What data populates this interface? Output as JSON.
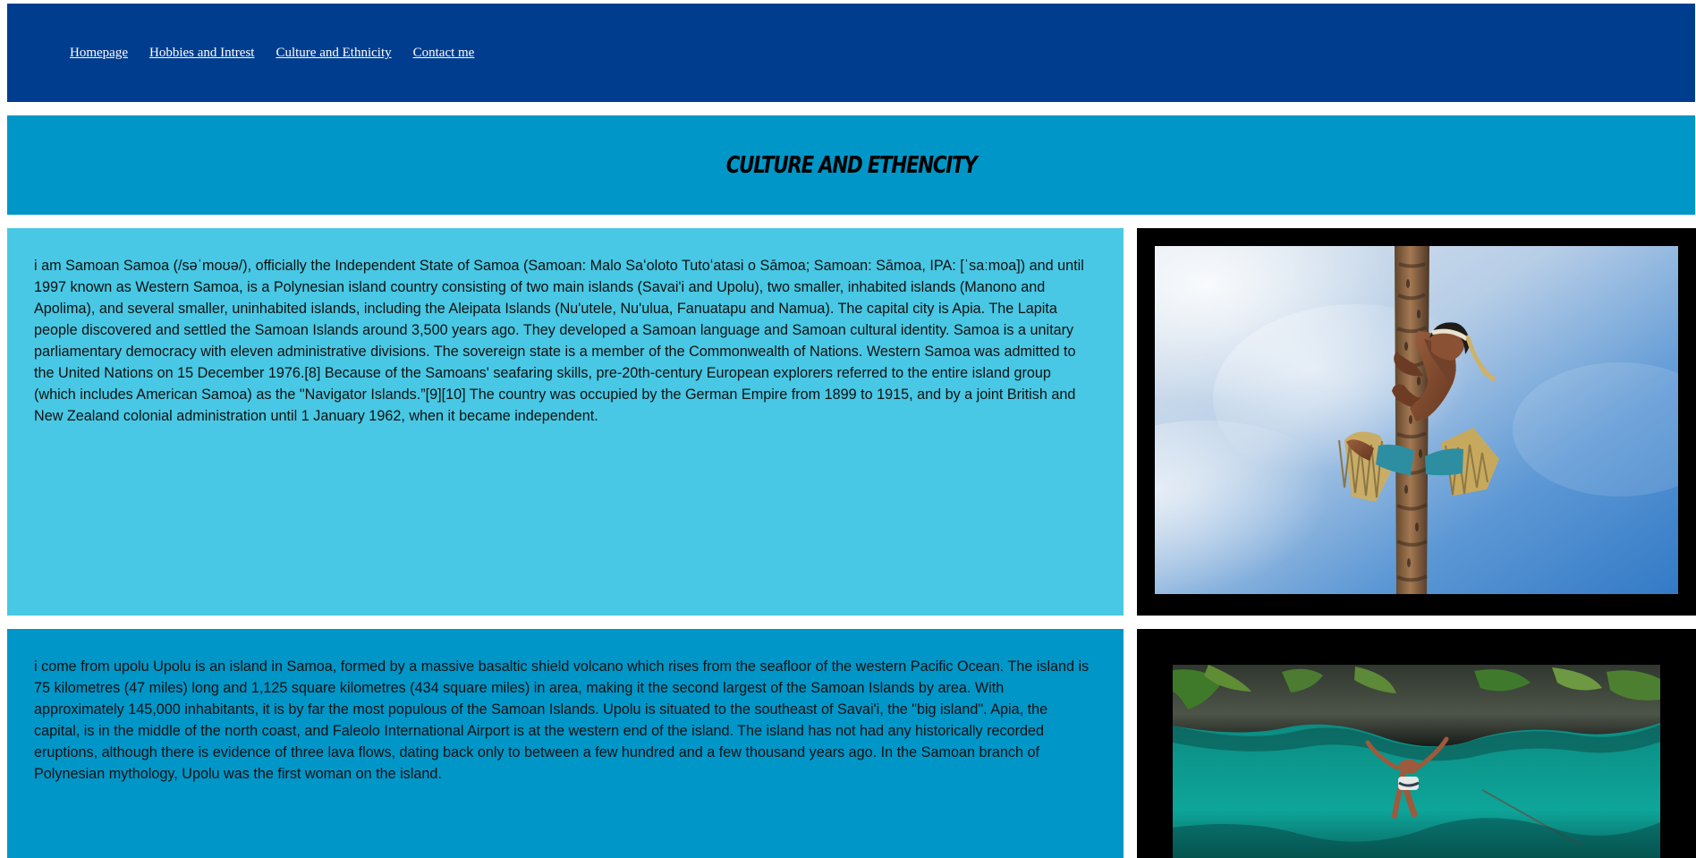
{
  "nav": {
    "items": [
      {
        "label": "Homepage"
      },
      {
        "label": "Hobbies and Intrest"
      },
      {
        "label": "Culture and Ethnicity"
      },
      {
        "label": "Contact me"
      }
    ]
  },
  "header": {
    "title": "CULTURE AND ETHENCITY"
  },
  "sections": [
    {
      "text": "i am Samoan Samoa (/səˈmoʊə/), officially the Independent State of Samoa (Samoan: Malo Saʻoloto Tutoʻatasi o Sāmoa; Samoan: Sāmoa, IPA: [ˈsaːmoa]) and until 1997 known as Western Samoa, is a Polynesian island country consisting of two main islands (Savai'i and Upolu), two smaller, inhabited islands (Manono and Apolima), and several smaller, uninhabited islands, including the Aleipata Islands (Nu'utele, Nu'ulua, Fanuatapu and Namua). The capital city is Apia. The Lapita people discovered and settled the Samoan Islands around 3,500 years ago. They developed a Samoan language and Samoan cultural identity. Samoa is a unitary parliamentary democracy with eleven administrative divisions. The sovereign state is a member of the Commonwealth of Nations. Western Samoa was admitted to the United Nations on 15 December 1976.[8] Because of the Samoans' seafaring skills, pre-20th-century European explorers referred to the entire island group (which includes American Samoa) as the \"Navigator Islands.”[9][10] The country was occupied by the German Empire from 1899 to 1915, and by a joint British and New Zealand colonial administration until 1 January 1962, when it became independent.",
      "image": "coconut-tree-climber-photo"
    },
    {
      "text": "i come from upolu Upolu is an island in Samoa, formed by a massive basaltic shield volcano which rises from the seafloor of the western Pacific Ocean. The island is 75 kilometres (47 miles) long and 1,125 square kilometres (434 square miles) in area, making it the second largest of the Samoan Islands by area. With approximately 145,000 inhabitants, it is by far the most populous of the Samoan Islands. Upolu is situated to the southeast of Savai'i, the \"big island\". Apia, the capital, is in the middle of the north coast, and Faleolo International Airport is at the western end of the island. The island has not had any historically recorded eruptions, although there is evidence of three lava flows, dating back only to between a few hundred and a few thousand years ago. In the Samoan branch of Polynesian mythology, Upolu was the first woman on the island.",
      "image": "trench-pool-jumper-photo"
    }
  ],
  "colors": {
    "nav_bg": "#003d8f",
    "title_bg": "#0096c8",
    "section_1_bg": "#48c8e4",
    "section_2_bg": "#0096c8",
    "image_frame_bg": "#000000"
  }
}
